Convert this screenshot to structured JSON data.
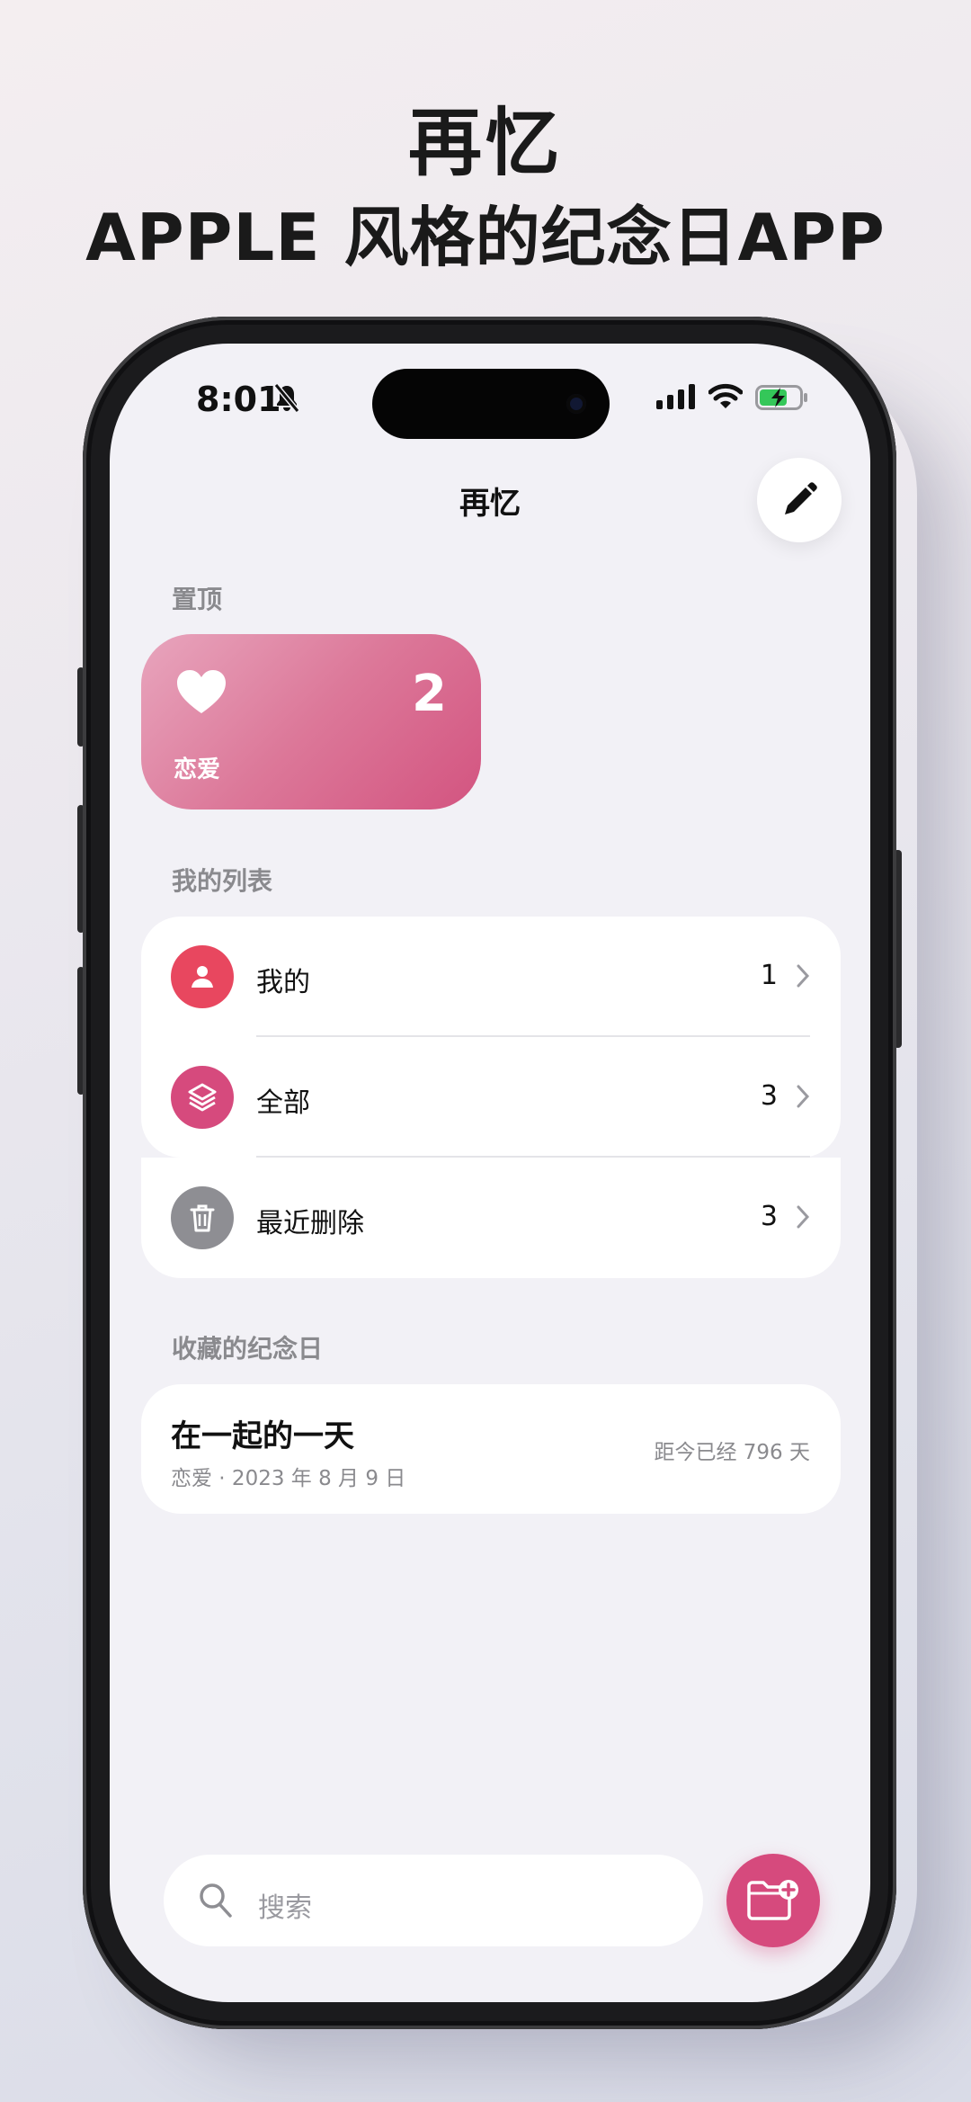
{
  "headline": {
    "line1": "再忆",
    "line2": "APPLE 风格的纪念日APP"
  },
  "status_bar": {
    "time": "8:01"
  },
  "nav": {
    "title": "再忆"
  },
  "pinned": {
    "section_label": "置顶",
    "card": {
      "name": "恋爱",
      "count": "2"
    }
  },
  "my_lists": {
    "section_label": "我的列表",
    "items": [
      {
        "label": "我的",
        "count": "1",
        "color": "#e8475f"
      },
      {
        "label": "全部",
        "count": "3",
        "color": "#d64a7d"
      },
      {
        "label": "最近删除",
        "count": "3",
        "color": "#8e8e93"
      }
    ]
  },
  "favorites": {
    "section_label": "收藏的纪念日",
    "items": [
      {
        "title": "在一起的一天",
        "subtitle": "恋爱 · 2023 年 8 月 9 日",
        "days": "距今已经 796 天"
      }
    ]
  },
  "search": {
    "placeholder": "搜索"
  },
  "colors": {
    "accent": "#d64a7d",
    "background": "#f2f1f6"
  }
}
